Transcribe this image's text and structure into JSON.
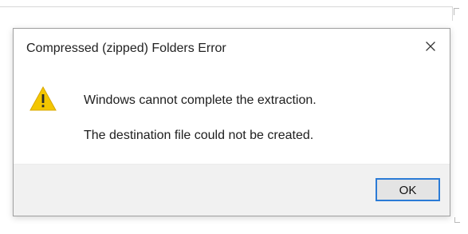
{
  "dialog": {
    "title": "Compressed (zipped) Folders Error",
    "icon": "warning-icon",
    "message": "Windows cannot complete the extraction.",
    "detail": "The destination file could not be created.",
    "button_ok": "OK"
  },
  "colors": {
    "accent": "#2b7bd6",
    "warning": "#f3c600",
    "footer_bg": "#f1f1f1"
  }
}
